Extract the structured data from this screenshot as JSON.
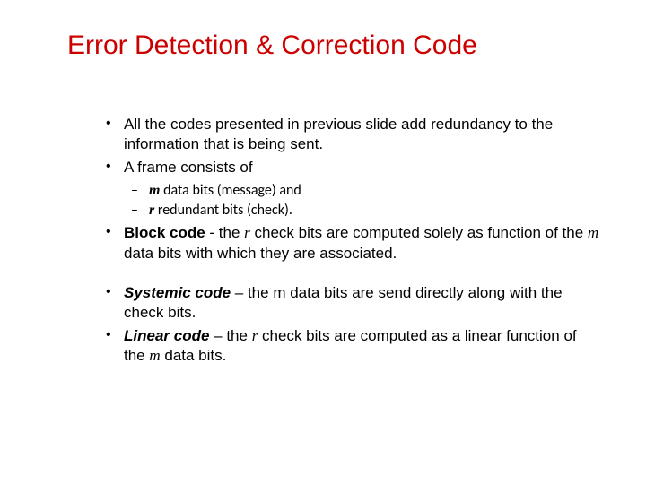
{
  "title": "Error Detection & Correction Code",
  "bullets": {
    "b1": "All the codes presented in previous slide add redundancy to the information that is being sent.",
    "b2": "A frame consists of",
    "b2a_m": "m",
    "b2a_rest": " data bits (message) and",
    "b2b_r": "r",
    "b2b_rest": " redundant bits (check).",
    "b3_label": "Block code",
    "b3_mid1": " - the ",
    "b3_r": "r",
    "b3_mid2": " check bits are computed solely as function of the ",
    "b3_m": "m",
    "b3_end": " data bits with which they are associated.",
    "b4_label": "Systemic code",
    "b4_rest": " – the m data bits are send directly along with the check bits.",
    "b5_label": "Linear code",
    "b5_mid1": " – the ",
    "b5_r": "r",
    "b5_mid2": " check bits are computed as a linear function of the ",
    "b5_m": "m",
    "b5_end": " data bits."
  }
}
